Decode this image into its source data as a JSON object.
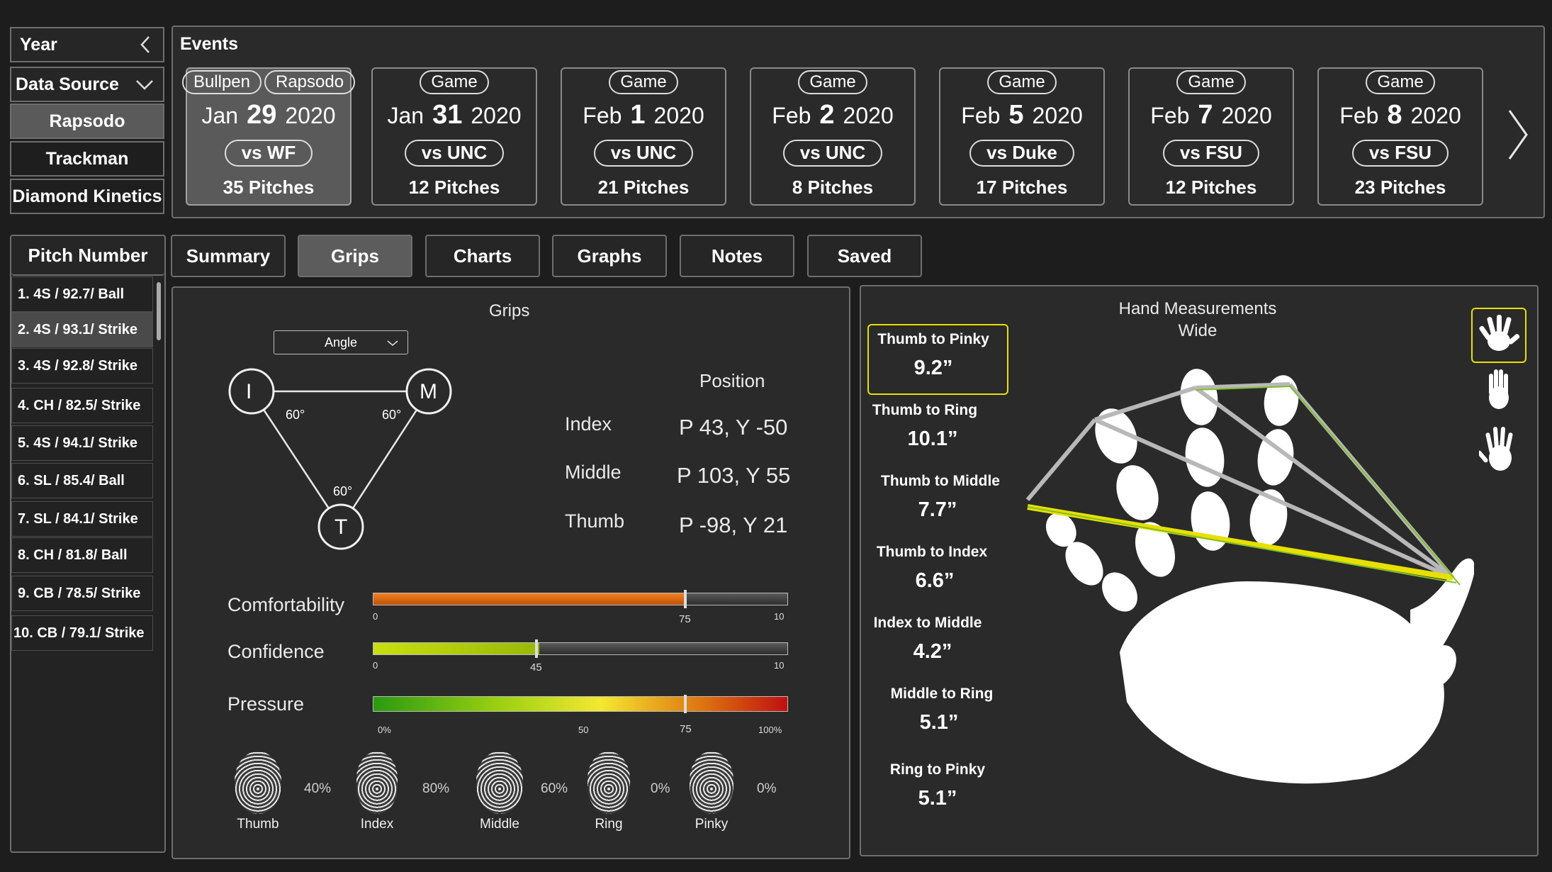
{
  "sidebar": {
    "year_label": "Year",
    "data_source_label": "Data Source",
    "sources": [
      "Rapsodo",
      "Trackman",
      "Diamond Kinetics"
    ],
    "selected_source": "Rapsodo"
  },
  "events": {
    "title": "Events",
    "cards": [
      {
        "tags": [
          "Bullpen",
          "Rapsodo"
        ],
        "month": "Jan",
        "day": "29",
        "year": "2020",
        "opponent": "vs WF",
        "pitches": "35 Pitches",
        "selected": true
      },
      {
        "tags": [
          "Game"
        ],
        "month": "Jan",
        "day": "31",
        "year": "2020",
        "opponent": "vs UNC",
        "pitches": "12 Pitches"
      },
      {
        "tags": [
          "Game"
        ],
        "month": "Feb",
        "day": "1",
        "year": "2020",
        "opponent": "vs UNC",
        "pitches": "21 Pitches"
      },
      {
        "tags": [
          "Game"
        ],
        "month": "Feb",
        "day": "2",
        "year": "2020",
        "opponent": "vs UNC",
        "pitches": "8 Pitches"
      },
      {
        "tags": [
          "Game"
        ],
        "month": "Feb",
        "day": "5",
        "year": "2020",
        "opponent": "vs Duke",
        "pitches": "17 Pitches"
      },
      {
        "tags": [
          "Game"
        ],
        "month": "Feb",
        "day": "7",
        "year": "2020",
        "opponent": "vs FSU",
        "pitches": "12 Pitches"
      },
      {
        "tags": [
          "Game"
        ],
        "month": "Feb",
        "day": "8",
        "year": "2020",
        "opponent": "vs FSU",
        "pitches": "23 Pitches"
      }
    ]
  },
  "pitch_list": {
    "header": "Pitch Number",
    "items": [
      "1. 4S / 92.7/ Ball",
      "2. 4S / 93.1/ Strike",
      "3. 4S / 92.8/ Strike",
      "4. CH / 82.5/ Strike",
      "5. 4S / 94.1/ Strike",
      "6. SL / 85.4/ Ball",
      "7. SL / 84.1/ Strike",
      "8. CH / 81.8/ Ball",
      "9. CB / 78.5/ Strike",
      "10. CB / 79.1/ Strike"
    ],
    "selected_index": 1
  },
  "tabs": [
    {
      "label": "Summary"
    },
    {
      "label": "Grips",
      "selected": true
    },
    {
      "label": "Charts"
    },
    {
      "label": "Graphs"
    },
    {
      "label": "Notes"
    },
    {
      "label": "Saved"
    }
  ],
  "grips": {
    "title": "Grips",
    "dropdown_value": "Angle",
    "triangle": {
      "nodes": [
        "I",
        "M",
        "T"
      ],
      "angles": [
        "60°",
        "60°",
        "60°"
      ]
    },
    "position_header": "Position",
    "positions": [
      {
        "finger": "Index",
        "value": "P 43, Y -50"
      },
      {
        "finger": "Middle",
        "value": "P 103, Y 55"
      },
      {
        "finger": "Thumb",
        "value": "P -98, Y 21"
      }
    ],
    "sliders": [
      {
        "label": "Comfortability",
        "value": 0.75,
        "ticks": [
          "0",
          "75",
          "10"
        ],
        "color": "#e06a10"
      },
      {
        "label": "Confidence",
        "value": 0.4,
        "ticks": [
          "0",
          "45",
          "10"
        ],
        "color": "#a8cc10"
      },
      {
        "label": "Pressure",
        "value": 0.75,
        "ticks": [
          "0%",
          "50",
          "75",
          "100%"
        ],
        "color": "gradient"
      }
    ],
    "fingers": [
      {
        "name": "Thumb",
        "pct": "40%"
      },
      {
        "name": "Index",
        "pct": "80%"
      },
      {
        "name": "Middle",
        "pct": "60%"
      },
      {
        "name": "Ring",
        "pct": "0%"
      },
      {
        "name": "Pinky",
        "pct": "0%"
      }
    ]
  },
  "hand": {
    "title_line1": "Hand Measurements",
    "title_line2": "Wide",
    "measurements": [
      {
        "label": "Thumb to Pinky",
        "value": "9.2”",
        "highlighted": true
      },
      {
        "label": "Thumb to Ring",
        "value": "10.1”"
      },
      {
        "label": "Thumb to Middle",
        "value": "7.7”"
      },
      {
        "label": "Thumb to Index",
        "value": "6.6”"
      },
      {
        "label": "Index to Middle",
        "value": "4.2”"
      },
      {
        "label": "Middle to Ring",
        "value": "5.1”"
      },
      {
        "label": "Ring to Pinky",
        "value": "5.1”"
      }
    ],
    "accent_color": "#e8e000"
  }
}
